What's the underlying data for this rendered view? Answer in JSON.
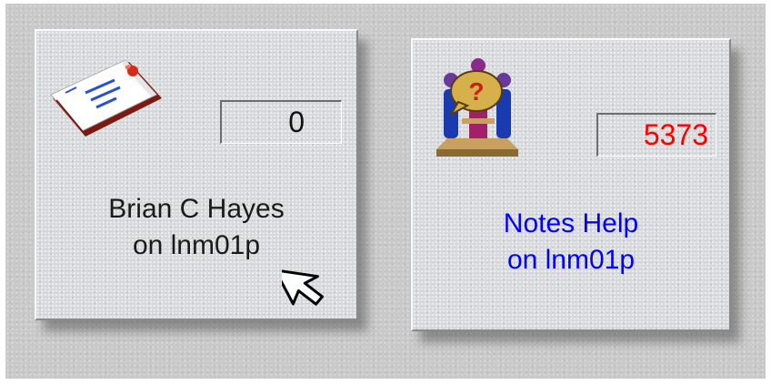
{
  "tiles": [
    {
      "icon": "envelope-icon",
      "count": "0",
      "name": "Brian C Hayes",
      "server": "on lnm01p",
      "count_color": "#111111",
      "label_color": "#1a1a1a"
    },
    {
      "icon": "help-people-icon",
      "count": "5373",
      "name": "Notes Help",
      "server": "on lnm01p",
      "count_color": "#ff0000",
      "label_color": "#0000ff"
    }
  ],
  "cursor": "arrow-cursor-icon"
}
